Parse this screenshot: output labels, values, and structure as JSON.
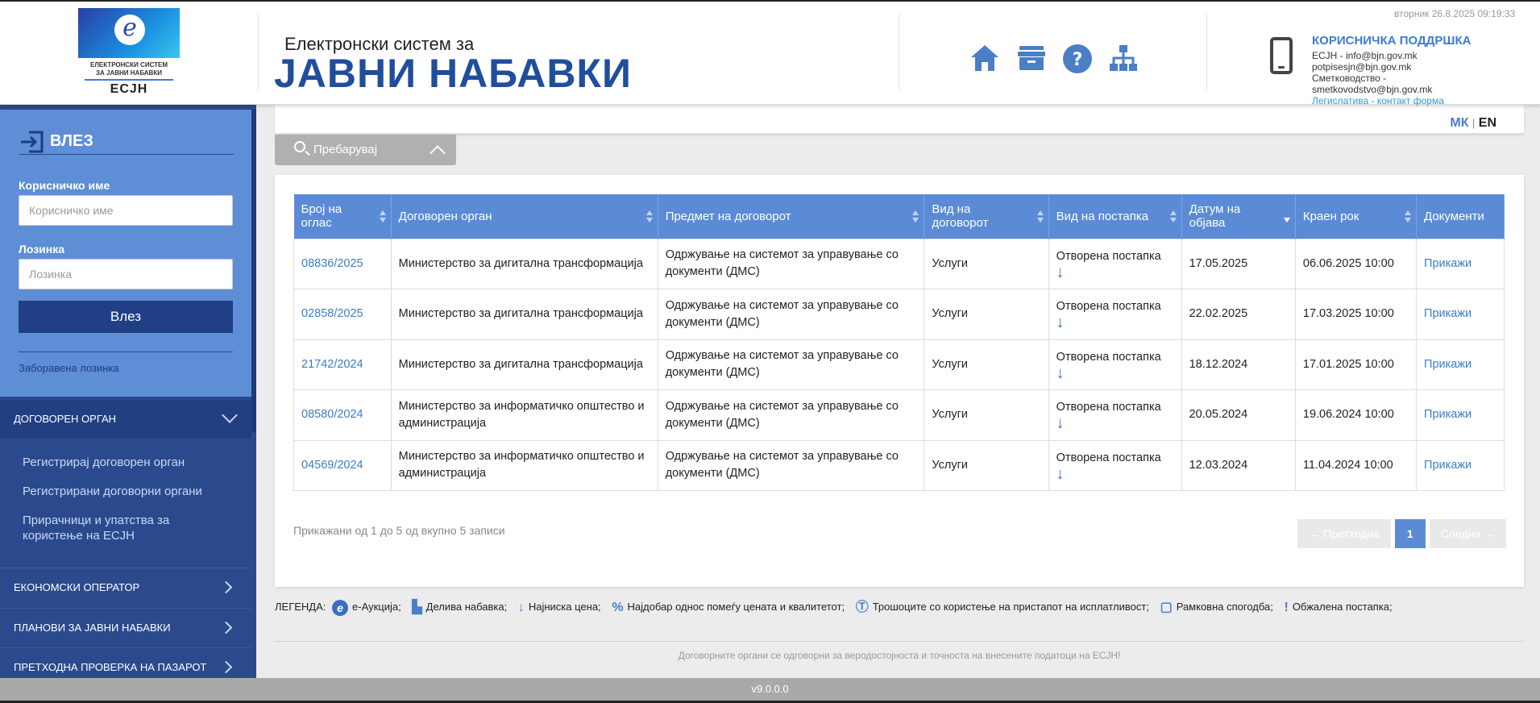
{
  "header": {
    "logo_lines": [
      "ЕЛЕКТРОНСКИ СИСТЕМ",
      "ЗА ЈАВНИ НАБАВКИ"
    ],
    "logo_abbr": "ECJH",
    "title_small": "Електронски систем за",
    "title_big": "ЈАВНИ НАБАВКИ",
    "datetime": "вторник 26.8.2025 09:19:33",
    "nav_icons": [
      "home-icon",
      "archive-icon",
      "help-icon",
      "sitemap-icon"
    ],
    "support": {
      "title": "КОРИСНИЧКА ПОДДРШКА",
      "line1": "ЕСЈН - info@bjn.gov.mk",
      "line2": "potpisesjn@bjn.gov.mk",
      "line3": "Сметководство -",
      "line4": "smetkovodstvo@bjn.gov.mk",
      "link": "Легислатива - контакт форма"
    }
  },
  "sidebar": {
    "login_title": "ВЛЕЗ",
    "username_label": "Корисничко име",
    "username_placeholder": "Корисничко име",
    "password_label": "Лозинка",
    "password_placeholder": "Лозинка",
    "login_button": "Влез",
    "forgot_password": "Заборавена лозинка",
    "section_contracting": {
      "label": "ДОГОВОРЕН ОРГАН",
      "items": [
        "Регистрирај договорен орган",
        "Регистрирани договорни органи",
        "Прирачници и упатства за користење на ЕСЈН"
      ]
    },
    "sections": [
      "ЕКОНОМСКИ ОПЕРАТОР",
      "ПЛАНОВИ ЗА ЈАВНИ НАБАВКИ",
      "ПРЕТХОДНА ПРОВЕРКА НА ПАЗАРОТ"
    ]
  },
  "lang": {
    "mk": "МК",
    "sep": "|",
    "en": "EN"
  },
  "search": {
    "label": "Пребарувај"
  },
  "table": {
    "headers": [
      "Број на оглас",
      "Договорен орган",
      "Предмет на договорот",
      "Вид на договорот",
      "Вид на постапка",
      "Датум на објава",
      "Краен рок",
      "Документи"
    ],
    "rows": [
      {
        "num": "08836/2025",
        "org": "Министерство за дигитална трансформација",
        "subject": "Одржување на системот за управување со документи (ДМС)",
        "type": "Услуги",
        "procedure": "Отворена постапка",
        "published": "17.05.2025",
        "deadline": "06.06.2025 10:00",
        "docs": "Прикажи"
      },
      {
        "num": "02858/2025",
        "org": "Министерство за дигитална трансформација",
        "subject": "Одржување на системот за управување со документи (ДМС)",
        "type": "Услуги",
        "procedure": "Отворена постапка",
        "published": "22.02.2025",
        "deadline": "17.03.2025 10:00",
        "docs": "Прикажи"
      },
      {
        "num": "21742/2024",
        "org": "Министерство за дигитална трансформација",
        "subject": "Одржување на системот за управување со документи (ДМС)",
        "type": "Услуги",
        "procedure": "Отворена постапка",
        "published": "18.12.2024",
        "deadline": "17.01.2025 10:00",
        "docs": "Прикажи"
      },
      {
        "num": "08580/2024",
        "org": "Министерство за информатичко општество и администрација",
        "subject": "Одржување на системот за управување со документи (ДМС)",
        "type": "Услуги",
        "procedure": "Отворена постапка",
        "published": "20.05.2024",
        "deadline": "19.06.2024 10:00",
        "docs": "Прикажи"
      },
      {
        "num": "04569/2024",
        "org": "Министерство за информатичко општество и администрација",
        "subject": "Одржување на системот за управување со документи (ДМС)",
        "type": "Услуги",
        "procedure": "Отворена постапка",
        "published": "12.03.2024",
        "deadline": "11.04.2024 10:00",
        "docs": "Прикажи"
      }
    ],
    "info": "Прикажани од 1 до 5 од вкупно 5 записи",
    "pager": {
      "prev": "← Претходна",
      "page": "1",
      "next": "Следна →"
    }
  },
  "legend": {
    "label": "ЛЕГЕНДА:",
    "items": [
      {
        "icon": "e-auction-icon",
        "text": "е-Аукција;"
      },
      {
        "icon": "divisible-icon",
        "text": "Делива набавка;"
      },
      {
        "icon": "lowest-price-icon",
        "text": "Најниска цена;"
      },
      {
        "icon": "best-value-icon",
        "text": "Најдобар однос помеѓу цената и квалитетот;"
      },
      {
        "icon": "cost-effectiveness-icon",
        "text": "Трошоците со користење на пристапот на исплатливост;"
      },
      {
        "icon": "framework-icon",
        "text": "Рамковна спогодба;"
      },
      {
        "icon": "appealed-icon",
        "text": "Обжалена постапка;"
      }
    ]
  },
  "disclaimer": "Договорните органи се одговорни за веродостојноста и точноста на внесените податоци на ЕСЈН!",
  "footer": {
    "version": "v9.0.0.0"
  }
}
